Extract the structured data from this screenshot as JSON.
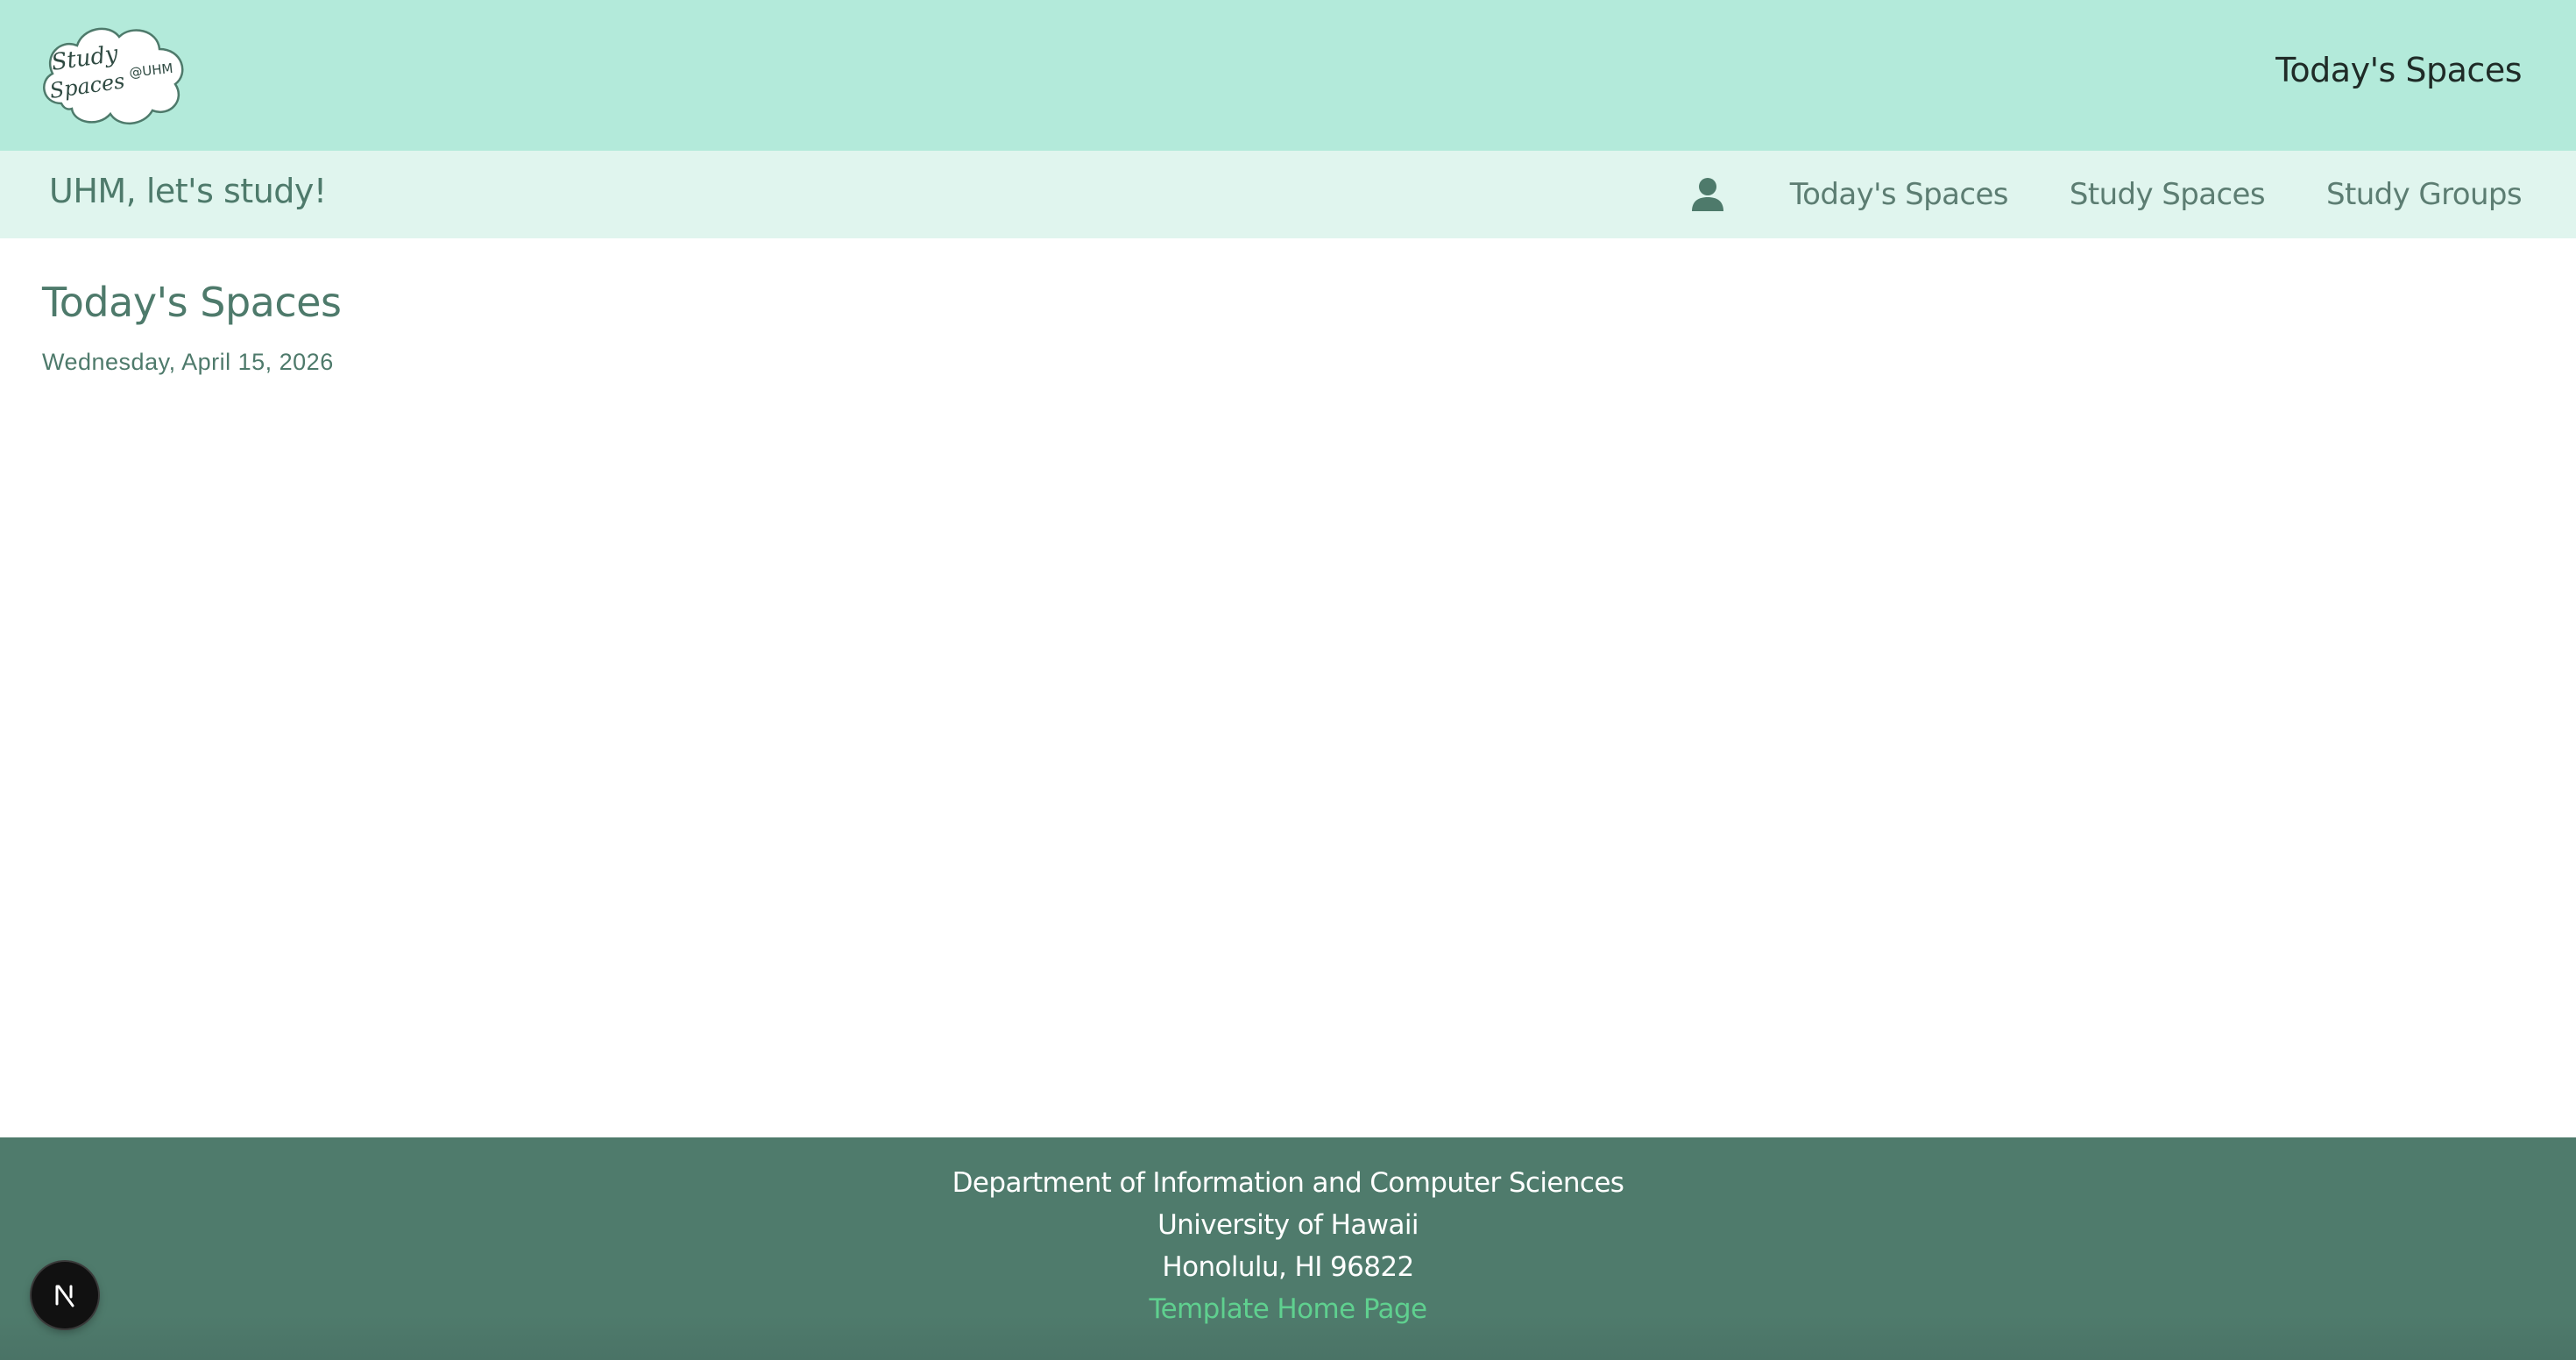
{
  "header": {
    "logo": {
      "icon": "study-spaces-cloud-logo",
      "lettering": [
        "Study",
        "Spaces",
        "@UHM"
      ]
    },
    "title": "Today's Spaces",
    "background": "#b3eada"
  },
  "navbar": {
    "brand": "UHM, let's study!",
    "user_icon": "user-icon",
    "links": [
      {
        "label": "Today's Spaces"
      },
      {
        "label": "Study Spaces"
      },
      {
        "label": "Study Groups"
      }
    ],
    "background": "#e0f5ee"
  },
  "main": {
    "heading": "Today's Spaces",
    "date": "Wednesday, April 15, 2026"
  },
  "footer": {
    "lines": [
      "Department of Information and Computer Sciences",
      "University of Hawaii",
      "Honolulu, HI 96822"
    ],
    "link": "Template Home Page",
    "background": "#4f7b6c",
    "link_color": "#5fd08f"
  },
  "dev_badge": {
    "icon": "nextjs-n-icon",
    "label": "N"
  },
  "colors": {
    "accent": "#4e7a6b",
    "banner": "#b3eada",
    "nav": "#e0f5ee"
  }
}
